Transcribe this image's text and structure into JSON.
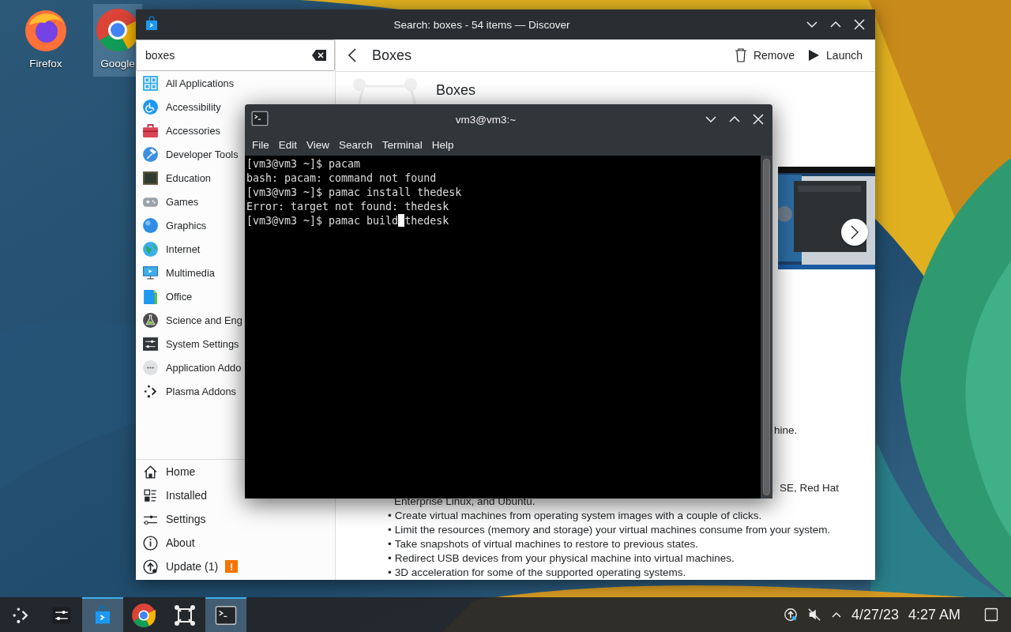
{
  "desktop_icons": [
    {
      "label": "Firefox",
      "selected": false
    },
    {
      "label": "Google",
      "selected": true
    }
  ],
  "discover": {
    "title": "Search: boxes - 54 items — Discover",
    "search": {
      "value": "boxes"
    },
    "categories": [
      {
        "label": "All Applications"
      },
      {
        "label": "Accessibility"
      },
      {
        "label": "Accessories"
      },
      {
        "label": "Developer Tools"
      },
      {
        "label": "Education"
      },
      {
        "label": "Games"
      },
      {
        "label": "Graphics"
      },
      {
        "label": "Internet"
      },
      {
        "label": "Multimedia"
      },
      {
        "label": "Office"
      },
      {
        "label": "Science and Eng"
      },
      {
        "label": "System Settings"
      },
      {
        "label": "Application Addo"
      },
      {
        "label": "Plasma Addons"
      }
    ],
    "nav": [
      {
        "label": "Home"
      },
      {
        "label": "Installed"
      },
      {
        "label": "Settings"
      },
      {
        "label": "About"
      },
      {
        "label": "Update (1)",
        "badge": "!"
      }
    ],
    "page": {
      "title": "Boxes",
      "actions": [
        "Remove",
        "Launch"
      ],
      "app_name": "Boxes",
      "fragments": [
        "hine.",
        "SE, Red Hat"
      ],
      "continuation": "Enterprise Linux, and Ubuntu.",
      "bullet_marker": "•",
      "bullets": [
        "Create virtual machines from operating system images with a couple of clicks.",
        "Limit the resources (memory and storage) your virtual machines consume from your system.",
        "Take snapshots of virtual machines to restore to previous states.",
        "Redirect USB devices from your physical machine into virtual machines.",
        "3D acceleration for some of the supported operating systems."
      ]
    }
  },
  "terminal": {
    "title": "vm3@vm3:~",
    "menu": [
      "File",
      "Edit",
      "View",
      "Search",
      "Terminal",
      "Help"
    ],
    "lines": [
      "[vm3@vm3 ~]$ pacam",
      "bash: pacam: command not found",
      "[vm3@vm3 ~]$ pamac install thedesk",
      "Error: target not found: thedesk"
    ],
    "cursor_line": {
      "before": "[vm3@vm3 ~]$ pamac build",
      "after": "thedesk"
    }
  },
  "taskbar": {
    "tasks": [
      {
        "kind": "launcher",
        "selected": false
      },
      {
        "kind": "settings",
        "selected": false
      },
      {
        "kind": "discover",
        "selected": true
      },
      {
        "kind": "chrome",
        "selected": false
      },
      {
        "kind": "boxes",
        "selected": false
      },
      {
        "kind": "terminal",
        "selected": true
      }
    ],
    "date": "4/27/23",
    "time": "4:27 AM"
  }
}
